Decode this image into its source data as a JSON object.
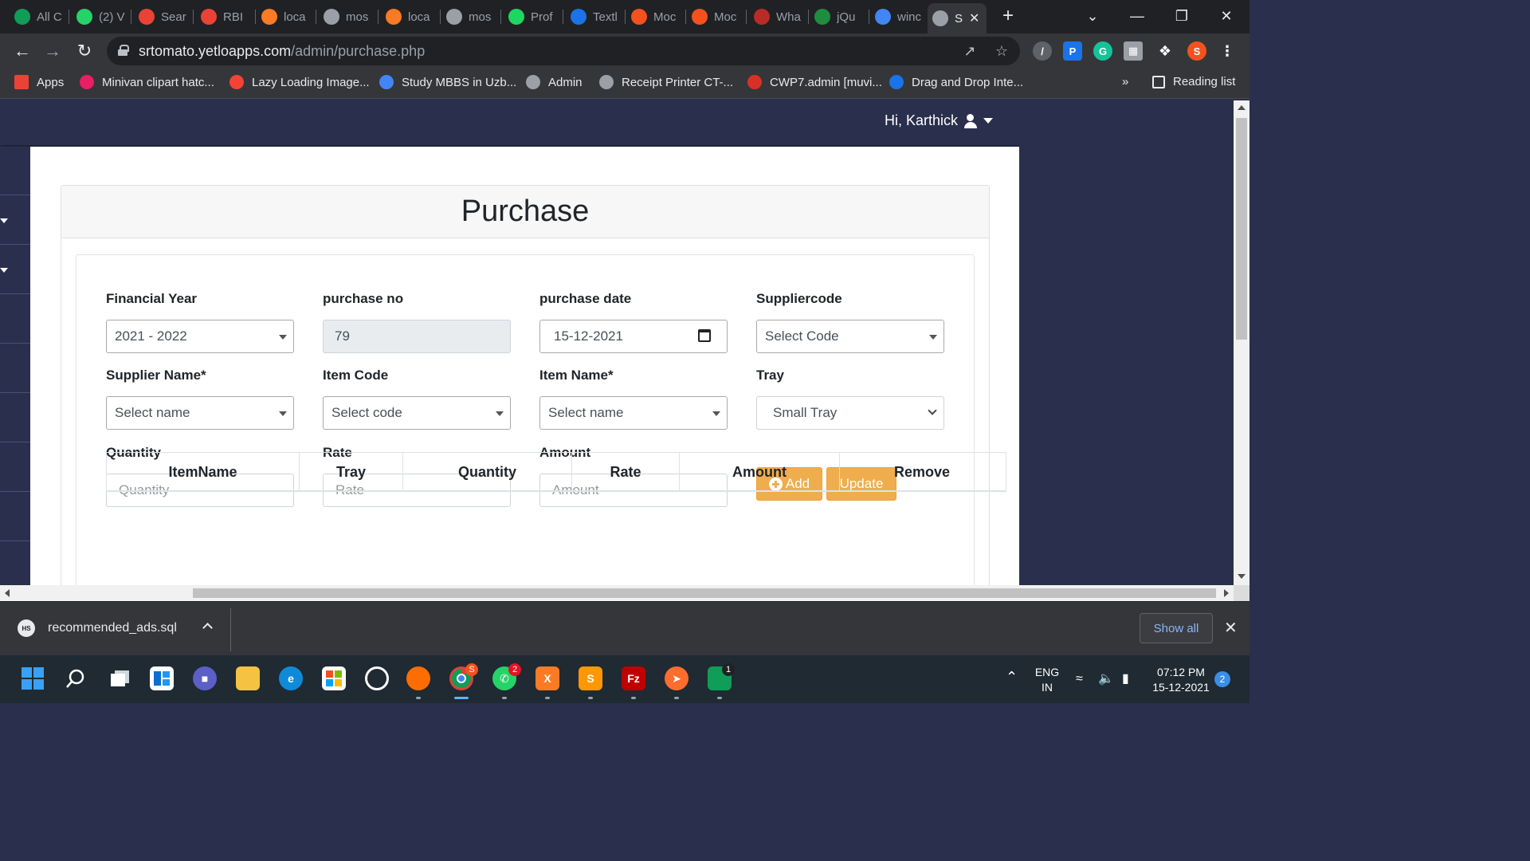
{
  "tabs": [
    {
      "label": "All C",
      "icon": "plus-square-icon",
      "color": "#0f9d58"
    },
    {
      "label": "(2) V",
      "icon": "whatsapp-icon",
      "color": "#25d366"
    },
    {
      "label": "Sear",
      "icon": "gmail-icon",
      "color": "#ea4335"
    },
    {
      "label": "RBI",
      "icon": "gmail-icon",
      "color": "#ea4335"
    },
    {
      "label": "loca",
      "icon": "xampp-icon",
      "color": "#fb7a24"
    },
    {
      "label": "mos",
      "icon": "globe-icon",
      "color": "#9aa0a6"
    },
    {
      "label": "loca",
      "icon": "xampp-icon",
      "color": "#fb7a24"
    },
    {
      "label": "mos",
      "icon": "globe-icon",
      "color": "#9aa0a6"
    },
    {
      "label": "Prof",
      "icon": "pen-icon",
      "color": "#1ed760"
    },
    {
      "label": "Textl",
      "icon": "t-icon",
      "color": "#1a73e8"
    },
    {
      "label": "Moc",
      "icon": "mockup-icon",
      "color": "#f4511e"
    },
    {
      "label": "Moc",
      "icon": "mockup-icon",
      "color": "#f4511e"
    },
    {
      "label": "Wha",
      "icon": "quora-icon",
      "color": "#b92b27"
    },
    {
      "label": "jQu",
      "icon": "w-icon",
      "color": "#1e8e3e"
    },
    {
      "label": "winc",
      "icon": "google-icon",
      "color": "#4285f4"
    },
    {
      "label": "S",
      "icon": "globe-icon",
      "color": "#9aa0a6",
      "active": true
    }
  ],
  "address": {
    "domain": "srtomato.yetloapps.com",
    "path": "/admin/purchase.php"
  },
  "bookmarks": [
    {
      "label": "Apps",
      "icon": "apps-grid-icon",
      "color": "#ea4335"
    },
    {
      "label": "Minivan clipart hatc...",
      "icon": "flower-icon",
      "color": "#e91e63"
    },
    {
      "label": "Lazy Loading Image...",
      "icon": "star-burst-icon",
      "color": "#f44336"
    },
    {
      "label": "Study MBBS in Uzb...",
      "icon": "google-icon",
      "color": "#4285f4"
    },
    {
      "label": "Admin",
      "icon": "globe-icon",
      "color": "#9aa0a6"
    },
    {
      "label": "Receipt Printer CT-...",
      "icon": "globe-icon",
      "color": "#9aa0a6"
    },
    {
      "label": "CWP7.admin [muvi...",
      "icon": "dash-icon",
      "color": "#d93025"
    },
    {
      "label": "Drag and Drop Inte...",
      "icon": "chat-icon",
      "color": "#1a73e8"
    }
  ],
  "bookmarks_more": "»",
  "reading_list": "Reading list",
  "header": {
    "greeting": "Hi, Karthick"
  },
  "page": {
    "title": "Purchase"
  },
  "form": {
    "financial_year": {
      "label": "Financial Year",
      "value": "2021 - 2022"
    },
    "purchase_no": {
      "label": "purchase no",
      "value": "79"
    },
    "purchase_date": {
      "label": "purchase date",
      "value": "15-12-2021"
    },
    "supplier_code": {
      "label": "Suppliercode",
      "value": "Select Code"
    },
    "supplier_name": {
      "label": "Supplier Name*",
      "value": "Select name"
    },
    "item_code": {
      "label": "Item Code",
      "value": "Select code"
    },
    "item_name": {
      "label": "Item Name*",
      "value": "Select name"
    },
    "tray": {
      "label": "Tray",
      "value": "Small Tray"
    },
    "quantity": {
      "label": "Quantity",
      "placeholder": "Quantity"
    },
    "rate": {
      "label": "Rate",
      "placeholder": "Rate"
    },
    "amount": {
      "label": "Amount",
      "placeholder": "Amount"
    },
    "add_label": "Add",
    "update_label": "Update"
  },
  "table": {
    "headers": [
      "ItemName",
      "Tray",
      "Quantity",
      "Rate",
      "Amount",
      "Remove"
    ]
  },
  "downloads": {
    "file": "recommended_ads.sql",
    "icon_text": "HS",
    "show_all": "Show all"
  },
  "taskbar": {
    "lang_line1": "ENG",
    "lang_line2": "IN",
    "time": "07:12 PM",
    "date": "15-12-2021",
    "notifications": "2",
    "whatsapp_badge": "2",
    "chrome_badge": "S",
    "app_badge": "1"
  },
  "colors": {
    "accent": "#f0ad4e",
    "navbar": "#2a2f4d"
  }
}
